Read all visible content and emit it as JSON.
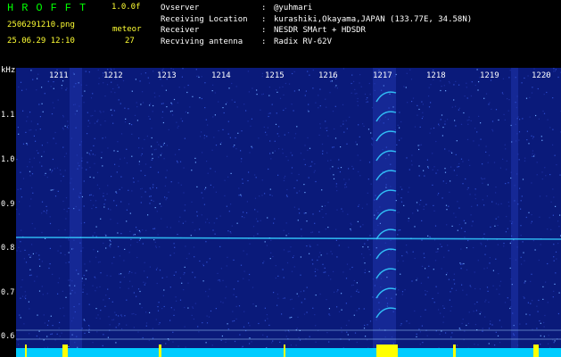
{
  "header": {
    "app_title": "HROFFT",
    "version": "1.0.0f",
    "filename": "2506291210.png",
    "timestamp": "25.06.29 12:10",
    "meteor_label": "meteor",
    "meteor_count": "27"
  },
  "info": {
    "rows": [
      {
        "label": "Ovserver",
        "sep": ":",
        "value": "@yuhmari"
      },
      {
        "label": "Receiving Location",
        "sep": ":",
        "value": "kurashiki,Okayama,JAPAN (133.77E, 34.58N)"
      },
      {
        "label": "Receiver",
        "sep": ":",
        "value": "NESDR SMArt + HDSDR"
      },
      {
        "label": "Recviving antenna",
        "sep": ":",
        "value": "Radix RV-62V"
      }
    ]
  },
  "axis": {
    "y_label": "kHz",
    "y_ticks": [
      "1.1",
      "1.0",
      "0.9",
      "0.8",
      "0.7",
      "0.6"
    ],
    "x_ticks": [
      "1211",
      "1212",
      "1213",
      "1214",
      "1215",
      "1216",
      "1217",
      "1218",
      "1219",
      "1220"
    ]
  },
  "colors": {
    "background": "#000000",
    "spectrum_base": "#0a1a7a",
    "trace": "#33ccff",
    "ticks": "#ffffff",
    "header_yellow": "#ffff33",
    "header_green": "#00ff00",
    "noise_floor": "#00ccff",
    "burst": "#ffff00"
  }
}
